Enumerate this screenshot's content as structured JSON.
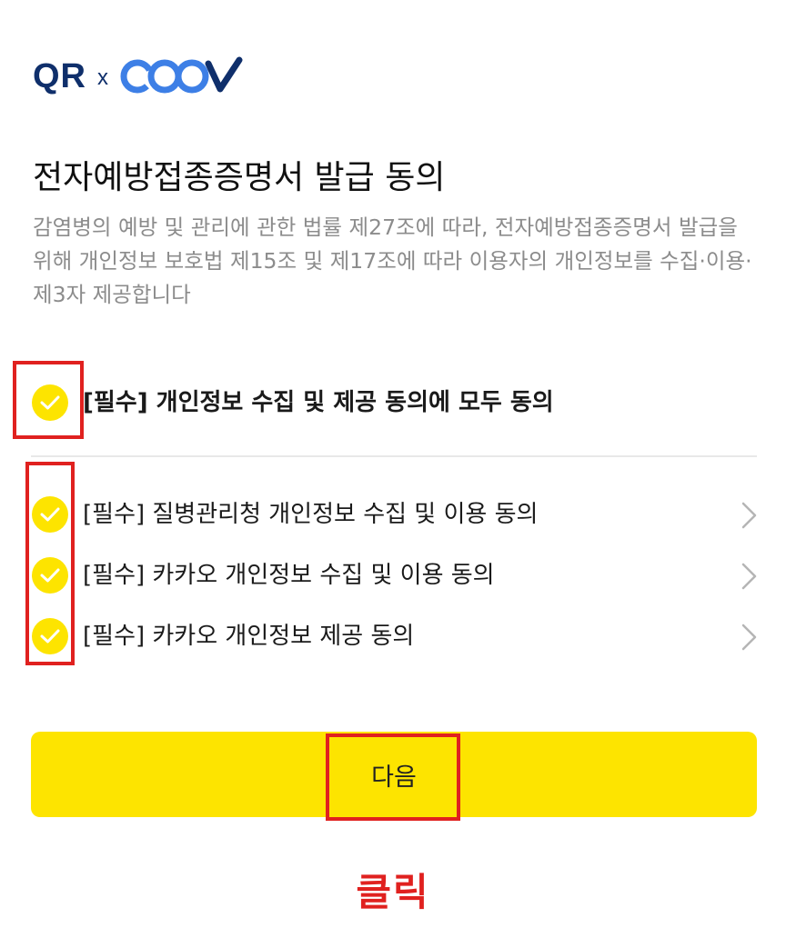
{
  "header": {
    "logo_qr": "QR",
    "logo_x": "x",
    "logo_coov": "COOV"
  },
  "page_title": "전자예방접종증명서 발급 동의",
  "description": "감염병의 예방 및 관리에 관한 법률 제27조에 따라, 전자예방접종증명서 발급을 위해 개인정보 보호법 제15조 및 제17조에 따라 이용자의 개인정보를 수집·이용·제3자 제공합니다",
  "consent_all": {
    "label": "[필수] 개인정보 수집 및 제공 동의에 모두 동의",
    "checked": true
  },
  "consents": [
    {
      "label": "[필수] 질병관리청 개인정보 수집 및 이용 동의",
      "checked": true
    },
    {
      "label": "[필수] 카카오 개인정보 수집 및 이용 동의",
      "checked": true
    },
    {
      "label": "[필수] 카카오 개인정보 제공 동의",
      "checked": true
    }
  ],
  "next_button_label": "다음",
  "annotation_caption": "클릭",
  "colors": {
    "accent_yellow": "#fde400",
    "logo_navy": "#0f2f6b",
    "logo_blue": "#3d7fe6",
    "annotation_red": "#e0211f",
    "description_gray": "#8c8c8c"
  },
  "icons": {
    "check": "check-circle-icon",
    "chevron": "chevron-right-icon"
  }
}
